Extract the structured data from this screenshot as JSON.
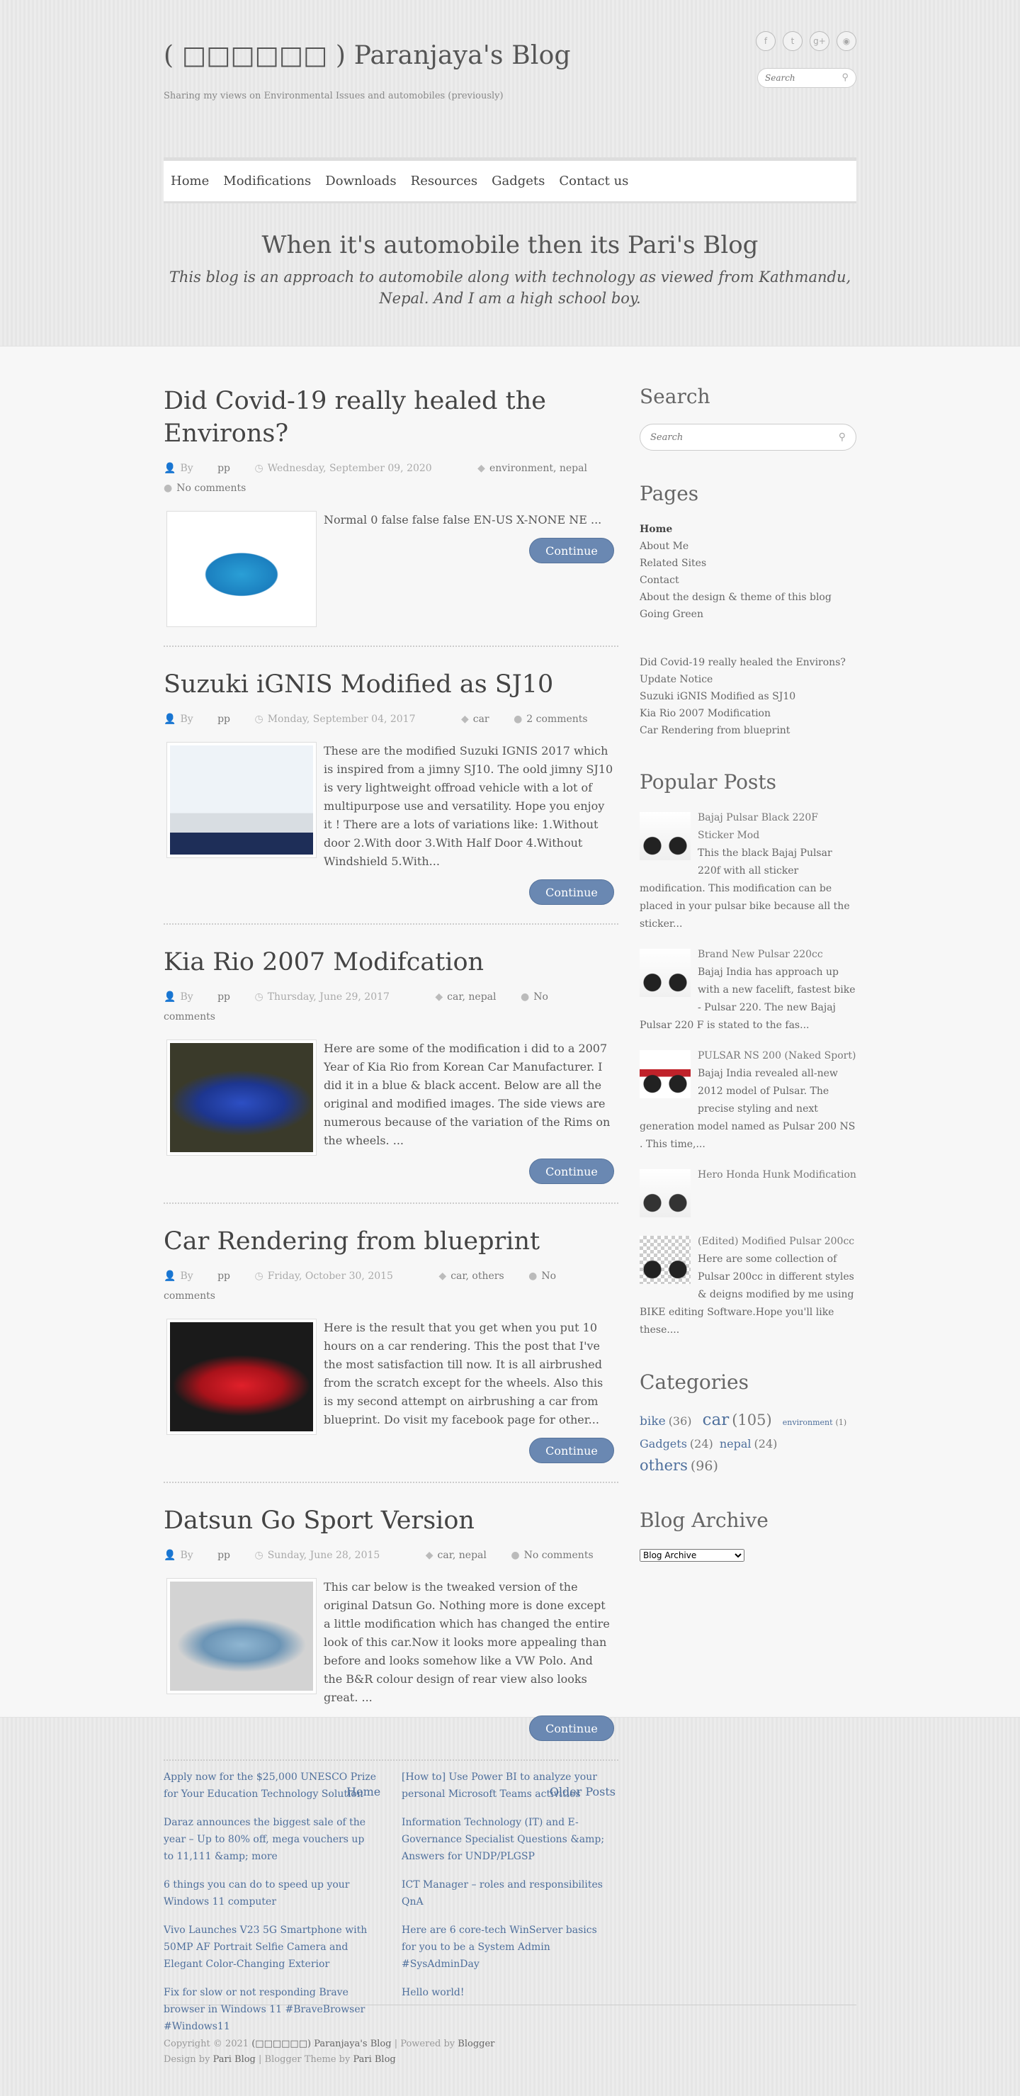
{
  "header": {
    "title": "( □□□□□□ ) Paranjaya's Blog",
    "description": "Sharing my views on Environmental Issues and automobiles (previously)",
    "social": [
      {
        "icon": "facebook-icon",
        "glyph": "f"
      },
      {
        "icon": "twitter-icon",
        "glyph": "t"
      },
      {
        "icon": "google-plus-icon",
        "glyph": "g+"
      },
      {
        "icon": "rss-icon",
        "glyph": "◉"
      }
    ],
    "search_placeholder": "Search"
  },
  "nav": [
    "Home",
    "Modifications",
    "Downloads",
    "Resources",
    "Gadgets",
    "Contact us"
  ],
  "tagline": {
    "heading": "When it's automobile then its Pari's Blog",
    "text": "This blog is an approach to automobile along with technology as viewed from Kathmandu, Nepal. And I am a high school boy."
  },
  "posts": [
    {
      "title": "Did Covid-19 really healed the Environs?",
      "by_label": "By",
      "author": "pp",
      "date": "Wednesday, September 09, 2020",
      "labels": "environment, nepal",
      "comments": "No comments",
      "excerpt": "Normal 0 false false false EN-US X-NONE NE ...",
      "image": "water-splash"
    },
    {
      "title": "Suzuki iGNIS Modified as SJ10",
      "by_label": "By",
      "author": "pp",
      "date": "Monday, September 04, 2017",
      "labels": "car",
      "comments": "2 comments",
      "excerpt": "These are the modified Suzuki IGNIS 2017 which is inspired from a jimny SJ10. The oold jimny SJ10 is very lightweight offroad vehicle with a lot of multipurpose use and versatility. Hope you enjoy it ! There are a lots of variations like: 1.Without door 2.With door 3.With Half Door 4.Without Windshield 5.With...",
      "image": "white-suv"
    },
    {
      "title": "Kia Rio 2007 Modifcation",
      "by_label": "By",
      "author": "pp",
      "date": "Thursday, June 29, 2017",
      "labels": "car, nepal",
      "comments": "No comments",
      "excerpt": "Here are some of the modification i did to a 2007 Year of Kia Rio from Korean Car Manufacturer. I did it in a blue & black accent. Below are all the original and modified images. The side views are numerous because of the variation of the Rims on the wheels. ...",
      "image": "blue-car"
    },
    {
      "title": "Car Rendering from blueprint",
      "by_label": "By",
      "author": "pp",
      "date": "Friday, October 30, 2015",
      "labels": "car, others",
      "comments": "No comments",
      "excerpt": "Here is the result that you get when you put 10 hours on a car rendering. This the post that I've the most satisfaction till now. It is all airbrushed from the scratch except for the wheels. Also this is my second attempt on airbrushing a car from blueprint.  Do visit my facebook page for other...",
      "image": "red-car"
    },
    {
      "title": "Datsun Go Sport Version",
      "by_label": "By",
      "author": "pp",
      "date": "Sunday, June 28, 2015",
      "labels": "car, nepal",
      "comments": "No comments",
      "excerpt": "This car below is the tweaked version of the original Datsun Go. Nothing more is done except a little modification which has changed the entire look of this car.Now it looks more appealing than before and looks somehow like a VW Polo. And the B&R colour design of rear view also looks great. ...",
      "image": "light-blue-car"
    }
  ],
  "continue_label": "Continue",
  "pager": {
    "home": "Home",
    "older": "Older Posts"
  },
  "sidebar": {
    "search_title": "Search",
    "search_placeholder": "Search",
    "pages_title": "Pages",
    "pages": [
      "Home",
      "About Me",
      "Related Sites",
      "Contact",
      "About the design & theme of this blog",
      "Going Green"
    ],
    "recent": [
      "Did Covid-19 really healed the Environs?",
      "Update Notice",
      "Suzuki iGNIS Modified as SJ10",
      "Kia Rio 2007 Modification",
      "Car Rendering from blueprint"
    ],
    "popular_title": "Popular Posts",
    "popular": [
      {
        "title": "Bajaj Pulsar Black 220F Sticker Mod",
        "text": "This the black Bajaj Pulsar 220f with all sticker modification. This modification can be placed in your pulsar bike because all the sticker..."
      },
      {
        "title": "Brand New Pulsar 220cc",
        "text": "Bajaj India has approach up with a new facelift, fastest bike - Pulsar 220. The new Bajaj Pulsar 220 F is stated to the fas..."
      },
      {
        "title": "PULSAR NS 200 (Naked Sport)",
        "text": "Bajaj India revealed all-new 2012 model of Pulsar. The precise styling and next generation model named as Pulsar 200 NS . This time,..."
      },
      {
        "title": "Hero Honda Hunk Modification",
        "text": ""
      },
      {
        "title": "(Edited) Modified Pulsar 200cc",
        "text": "Here are some collection of Pulsar 200cc in different styles & deigns modified by me using BIKE editing Software.Hope you'll like these...."
      }
    ],
    "categories_title": "Categories",
    "categories": [
      {
        "name": "bike",
        "count": "(36)"
      },
      {
        "name": "car",
        "count": "(105)"
      },
      {
        "name": "environment",
        "count": "(1)"
      },
      {
        "name": "Gadgets",
        "count": "(24)"
      },
      {
        "name": "nepal",
        "count": "(24)"
      },
      {
        "name": "others",
        "count": "(96)"
      }
    ],
    "archive_title": "Blog Archive",
    "archive_select": "Blog Archive"
  },
  "footer": {
    "col1": [
      "Apply now for the $25,000 UNESCO Prize for Your Education Technology Solution",
      "Daraz announces the biggest sale of the year – Up to 80% off, mega vouchers up to 11,111 &amp; more",
      "6 things you can do to speed up your Windows 11 computer",
      "Vivo Launches V23 5G Smartphone with 50MP AF Portrait Selfie Camera and Elegant Color-Changing Exterior",
      "Fix for slow or not responding Brave browser in Windows 11 #BraveBrowser #Windows11"
    ],
    "col2": [
      "[How to] Use Power BI to analyze your personal Microsoft Teams activities",
      "Information Technology (IT) and E-Governance Specialist Questions &amp; Answers for UNDP/PLGSP",
      "ICT Manager – roles and responsibilites QnA",
      "Here are 6 core-tech WinServer basics for you to be a System Admin #SysAdminDay",
      "Hello world!"
    ],
    "copyright": "Copyright © 2021",
    "blog_name": "(□□□□□□) Paranjaya's Blog",
    "powered": "| Powered by",
    "blogger": "Blogger",
    "design_by": "Design by",
    "pari_blog": "Pari Blog",
    "theme_by": "| Blogger Theme by"
  }
}
